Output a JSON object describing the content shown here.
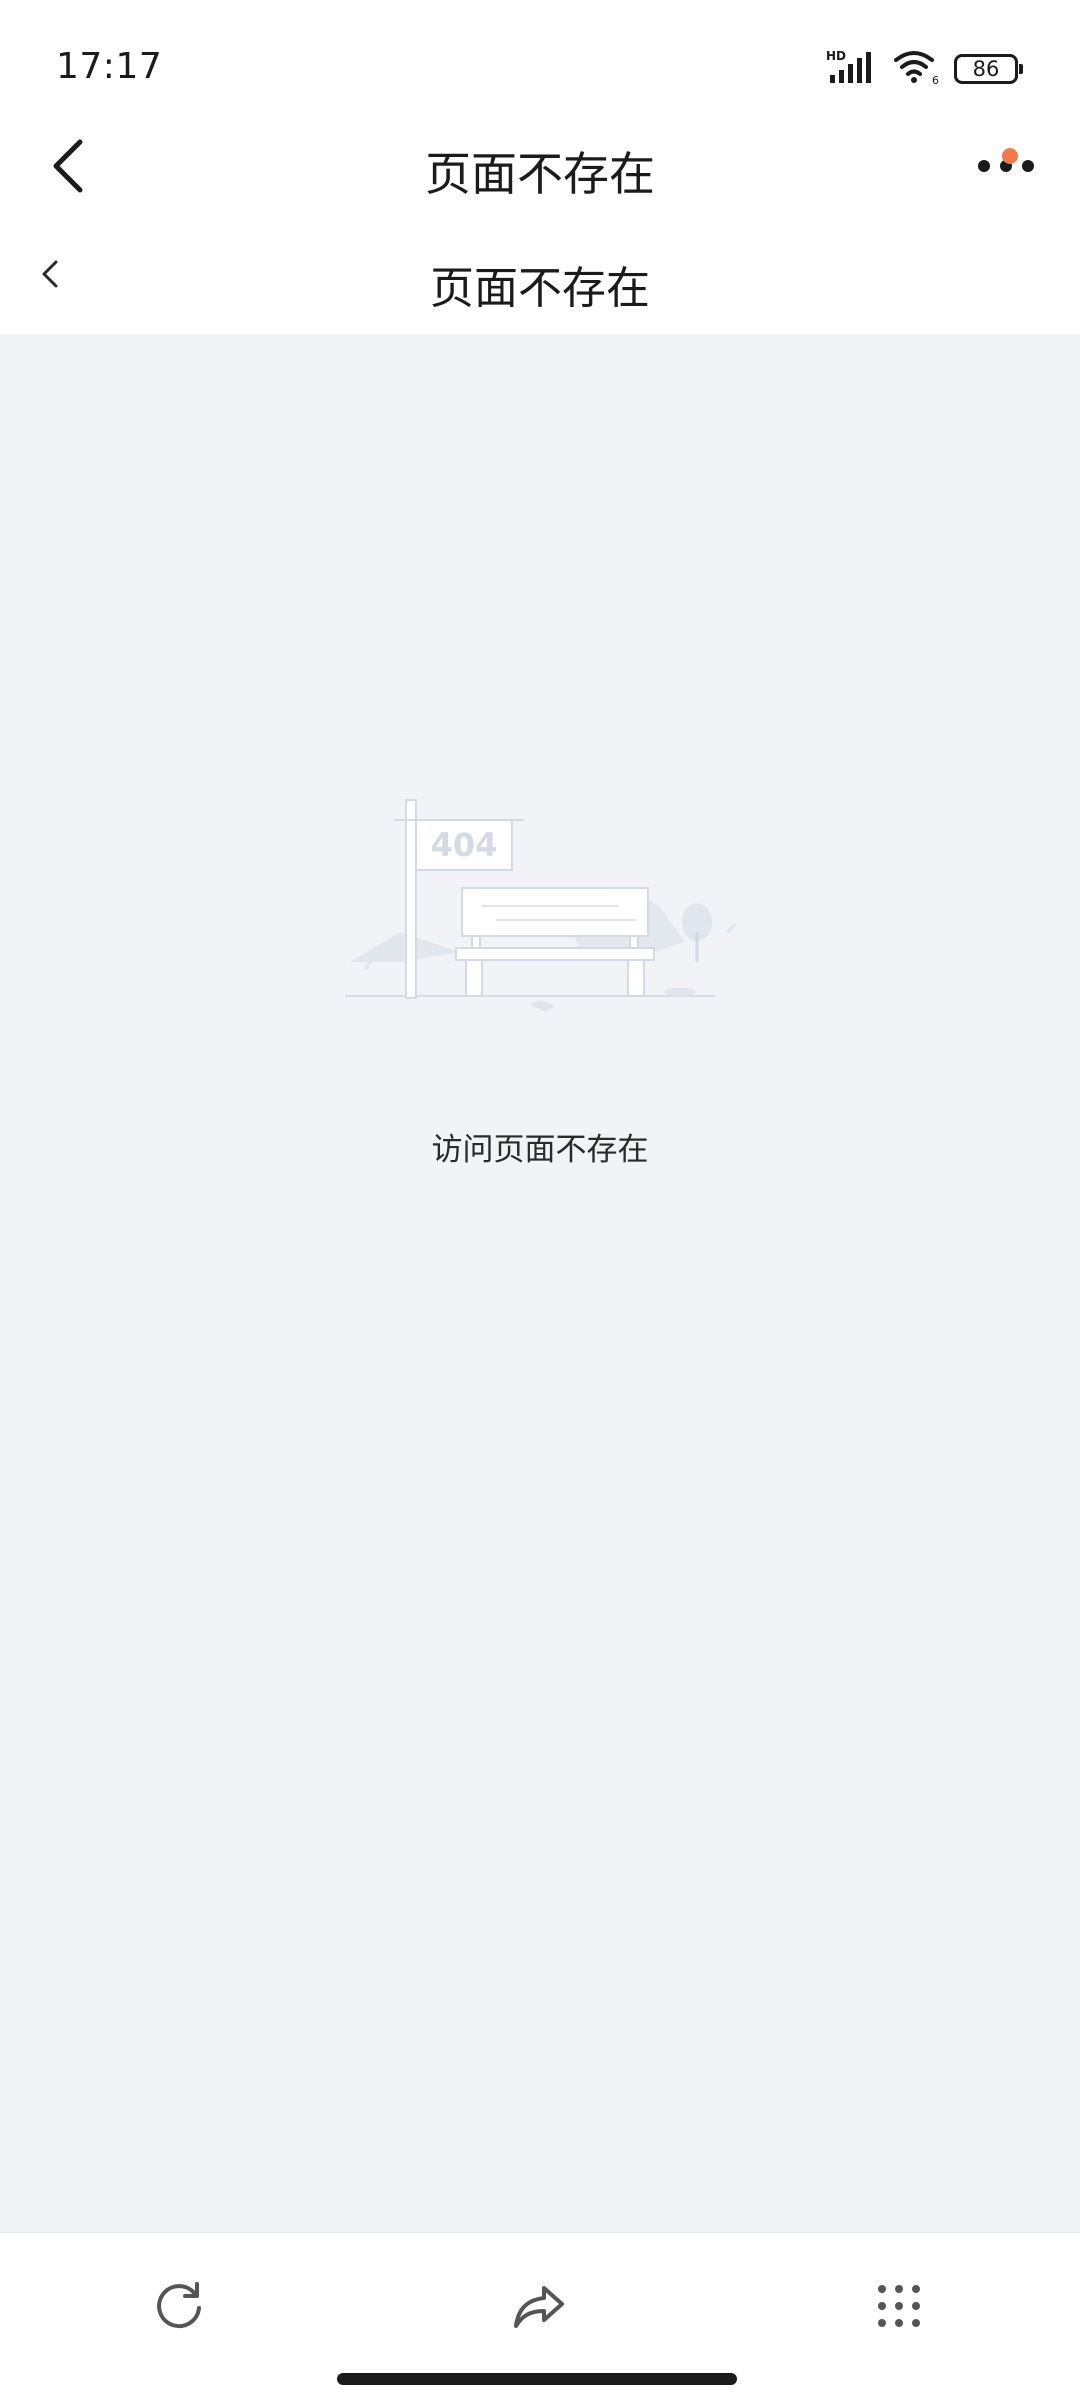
{
  "status_bar": {
    "time": "17:17",
    "network_label": "HD",
    "battery_level": "86",
    "icons": [
      "signal-icon",
      "wifi-icon",
      "battery-icon"
    ]
  },
  "app_bar": {
    "title": "页面不存在",
    "icons": [
      "back-arrow-icon",
      "more-dots-icon"
    ],
    "notification_dot_color": "#f07a4a"
  },
  "web_header": {
    "title": "页面不存在",
    "icons": [
      "chevron-left-icon"
    ]
  },
  "content": {
    "illustration_sign_text": "404",
    "message": "访问页面不存在",
    "background_color": "#f1f3f7"
  },
  "bottom_bar": {
    "icons": [
      "refresh-icon",
      "share-icon",
      "grid-menu-icon"
    ]
  }
}
